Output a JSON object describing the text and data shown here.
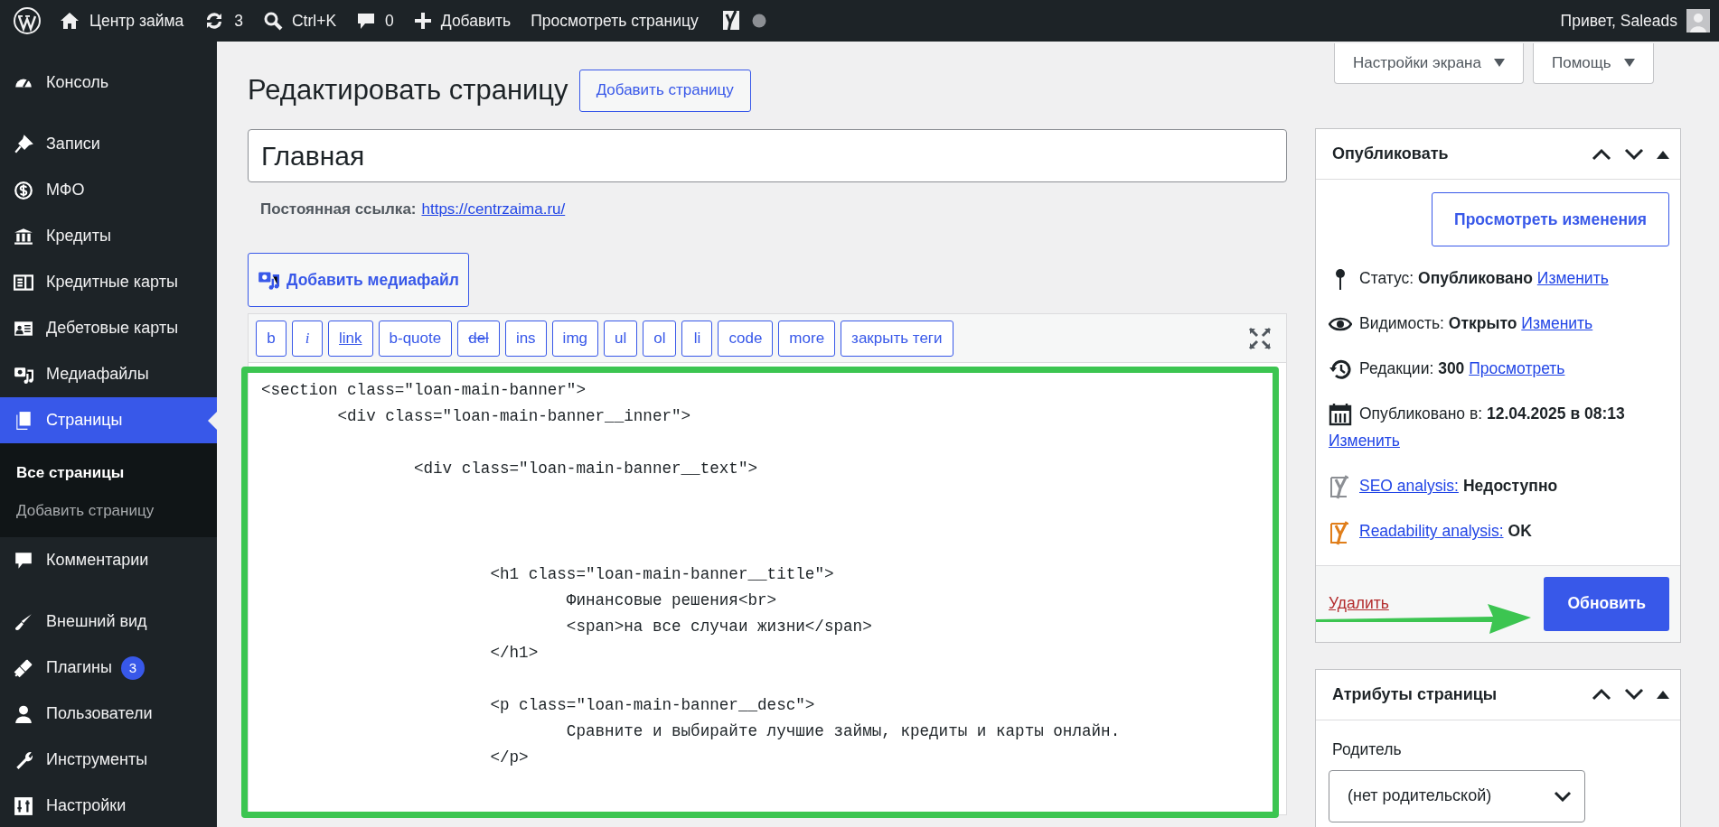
{
  "admin_bar": {
    "site": "Центр займа",
    "updates": "3",
    "search": "Ctrl+K",
    "comments": "0",
    "new": "Добавить",
    "view": "Просмотреть страницу",
    "greeting": "Привет, Saleads"
  },
  "sidebar": {
    "groups": [
      [
        {
          "label": "Консоль",
          "selected": false
        }
      ],
      [
        {
          "label": "Записи",
          "selected": false
        },
        {
          "label": "МФО",
          "selected": false
        },
        {
          "label": "Кредиты",
          "selected": false
        },
        {
          "label": "Кредитные карты",
          "selected": false
        },
        {
          "label": "Дебетовые карты",
          "selected": false
        },
        {
          "label": "Медиафайлы",
          "selected": false
        },
        {
          "label": "Страницы",
          "selected": true,
          "children": [
            {
              "label": "Все страницы",
              "selected": true
            },
            {
              "label": "Добавить страницу",
              "selected": false
            }
          ]
        },
        {
          "label": "Комментарии",
          "selected": false
        }
      ],
      [
        {
          "label": "Внешний вид",
          "selected": false
        },
        {
          "label": "Плагины",
          "selected": false,
          "badge": "3"
        },
        {
          "label": "Пользователи",
          "selected": false
        },
        {
          "label": "Инструменты",
          "selected": false
        },
        {
          "label": "Настройки",
          "selected": false
        }
      ]
    ]
  },
  "screen_tabs": [
    "Настройки экрана",
    "Помощь"
  ],
  "heading": "Редактировать страницу",
  "add_new": "Добавить страницу",
  "title_field": {
    "value": "Главная"
  },
  "permalink": {
    "label": "Постоянная ссылка:",
    "url": "https://centrzaima.ru/"
  },
  "add_media": "Добавить медиафайл",
  "quicktags": [
    {
      "label": "b",
      "kind": "plain"
    },
    {
      "label": "i",
      "kind": "italic"
    },
    {
      "label": "link",
      "kind": "underline"
    },
    {
      "label": "b-quote",
      "kind": "plain"
    },
    {
      "label": "del",
      "kind": "strike"
    },
    {
      "label": "ins",
      "kind": "plain"
    },
    {
      "label": "img",
      "kind": "plain"
    },
    {
      "label": "ul",
      "kind": "plain"
    },
    {
      "label": "ol",
      "kind": "plain"
    },
    {
      "label": "li",
      "kind": "plain"
    },
    {
      "label": "code",
      "kind": "plain"
    },
    {
      "label": "more",
      "kind": "plain"
    },
    {
      "label": "закрыть теги",
      "kind": "plain"
    }
  ],
  "code": "<section class=\"loan-main-banner\">\n\t<div class=\"loan-main-banner__inner\">\n\n\t\t<div class=\"loan-main-banner__text\">\n\n\n\n\t\t\t<h1 class=\"loan-main-banner__title\">\n\t\t\t\tФинансовые решения<br>\n\t\t\t\t<span>на все случаи жизни</span>\n\t\t\t</h1>\n\n\t\t\t<p class=\"loan-main-banner__desc\">\n\t\t\t\tСравните и выбирайте лучшие займы, кредиты и карты онлайн.\n\t\t\t</p>",
  "publish": {
    "title": "Опубликовать",
    "preview_button": "Просмотреть изменения",
    "rows": [
      {
        "text": "Статус: **Опубликовано**",
        "link": "Изменить"
      },
      {
        "text": "Видимость: **Открыто**",
        "link": "Изменить"
      },
      {
        "text": "Редакции: **300**",
        "link": "Просмотреть"
      },
      {
        "text": "Опубликовано в: **12.04.2025 в 08:13**",
        "link": "Изменить"
      }
    ],
    "analysis": [
      {
        "link": "SEO analysis:",
        "value": "Недоступно",
        "color": "#8c8f94"
      },
      {
        "link": "Readability analysis:",
        "value": "OK",
        "color": "#e07e1a"
      }
    ],
    "delete": "Удалить",
    "update": "Обновить"
  },
  "page_attributes": {
    "title": "Атрибуты страницы",
    "parent_label": "Родитель",
    "parent_value": "(нет родительской)"
  }
}
